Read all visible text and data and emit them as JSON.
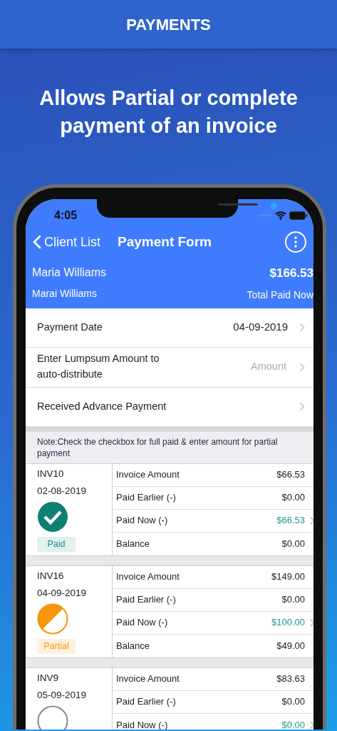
{
  "banner": {
    "title": "PAYMENTS"
  },
  "headline": "Allows Partial or complete payment of an invoice",
  "status_bar": {
    "time": "4:05"
  },
  "nav": {
    "back": "Client List",
    "title": "Payment Form"
  },
  "client": {
    "name": "Maria Williams",
    "subname": "Marai Williams",
    "total": "$166.53",
    "total_label": "Total Paid Now"
  },
  "form_rows": [
    {
      "label": "Payment Date",
      "value": "04-09-2019",
      "kind": "value"
    },
    {
      "label": "Enter Lumpsum Amount to auto-distribute",
      "placeholder": "Amount",
      "kind": "input"
    },
    {
      "label": "Received Advance Payment",
      "kind": "link"
    }
  ],
  "note": "Note:Check the checkbox for full paid & enter amount for partial payment",
  "invoices": [
    {
      "number": "INV10",
      "date": "02-08-2019",
      "kind": "paid",
      "badge": "Paid",
      "rows": [
        {
          "label": "Invoice Amount",
          "value": "$66.53"
        },
        {
          "label": "Paid Earlier (-)",
          "value": "$0.00"
        },
        {
          "label": "Paid Now (-)",
          "value": "$66.53",
          "kind": "editable"
        },
        {
          "label": "Balance",
          "value": "$0.00"
        }
      ]
    },
    {
      "number": "INV16",
      "date": "04-09-2019",
      "kind": "partial",
      "badge": "Partial",
      "rows": [
        {
          "label": "Invoice Amount",
          "value": "$149.00"
        },
        {
          "label": "Paid Earlier (-)",
          "value": "$0.00"
        },
        {
          "label": "Paid Now (-)",
          "value": "$100.00",
          "kind": "editable"
        },
        {
          "label": "Balance",
          "value": "$49.00"
        }
      ]
    },
    {
      "number": "INV9",
      "date": "05-09-2019",
      "kind": "unpaid",
      "rows": [
        {
          "label": "Invoice Amount",
          "value": "$83.63"
        },
        {
          "label": "Paid Earlier (-)",
          "value": "$0.00"
        },
        {
          "label": "Paid Now (-)",
          "value": "$0.00",
          "kind": "editable"
        }
      ]
    }
  ]
}
